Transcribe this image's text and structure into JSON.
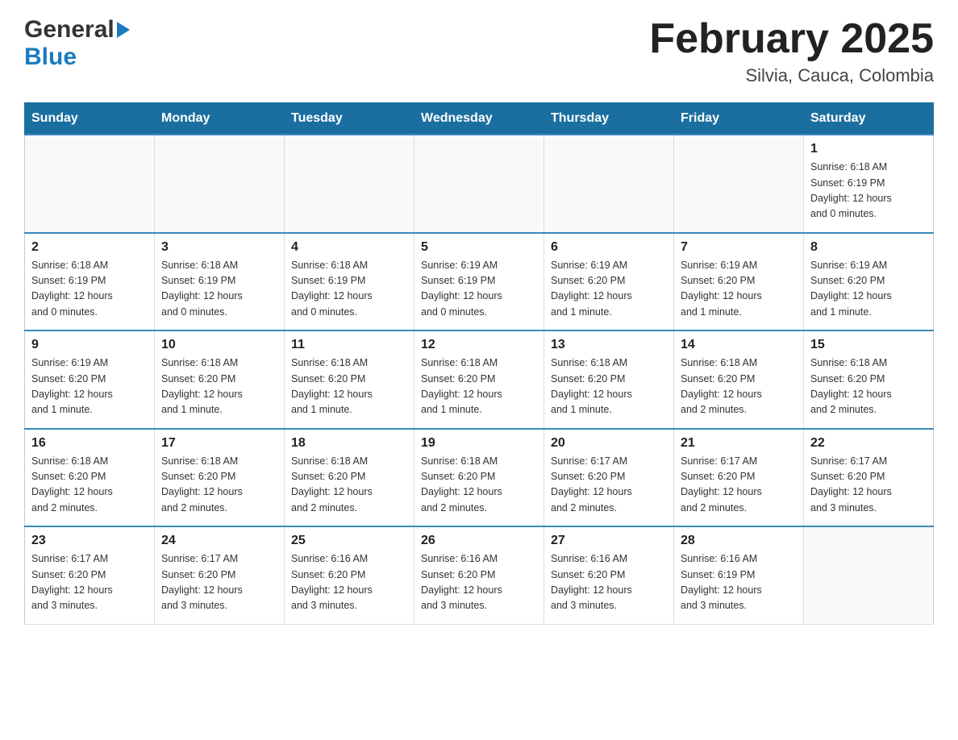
{
  "header": {
    "logo_general": "General",
    "logo_blue": "Blue",
    "month_title": "February 2025",
    "location": "Silvia, Cauca, Colombia"
  },
  "days_of_week": [
    "Sunday",
    "Monday",
    "Tuesday",
    "Wednesday",
    "Thursday",
    "Friday",
    "Saturday"
  ],
  "weeks": [
    {
      "days": [
        {
          "num": "",
          "info": ""
        },
        {
          "num": "",
          "info": ""
        },
        {
          "num": "",
          "info": ""
        },
        {
          "num": "",
          "info": ""
        },
        {
          "num": "",
          "info": ""
        },
        {
          "num": "",
          "info": ""
        },
        {
          "num": "1",
          "info": "Sunrise: 6:18 AM\nSunset: 6:19 PM\nDaylight: 12 hours\nand 0 minutes."
        }
      ]
    },
    {
      "days": [
        {
          "num": "2",
          "info": "Sunrise: 6:18 AM\nSunset: 6:19 PM\nDaylight: 12 hours\nand 0 minutes."
        },
        {
          "num": "3",
          "info": "Sunrise: 6:18 AM\nSunset: 6:19 PM\nDaylight: 12 hours\nand 0 minutes."
        },
        {
          "num": "4",
          "info": "Sunrise: 6:18 AM\nSunset: 6:19 PM\nDaylight: 12 hours\nand 0 minutes."
        },
        {
          "num": "5",
          "info": "Sunrise: 6:19 AM\nSunset: 6:19 PM\nDaylight: 12 hours\nand 0 minutes."
        },
        {
          "num": "6",
          "info": "Sunrise: 6:19 AM\nSunset: 6:20 PM\nDaylight: 12 hours\nand 1 minute."
        },
        {
          "num": "7",
          "info": "Sunrise: 6:19 AM\nSunset: 6:20 PM\nDaylight: 12 hours\nand 1 minute."
        },
        {
          "num": "8",
          "info": "Sunrise: 6:19 AM\nSunset: 6:20 PM\nDaylight: 12 hours\nand 1 minute."
        }
      ]
    },
    {
      "days": [
        {
          "num": "9",
          "info": "Sunrise: 6:19 AM\nSunset: 6:20 PM\nDaylight: 12 hours\nand 1 minute."
        },
        {
          "num": "10",
          "info": "Sunrise: 6:18 AM\nSunset: 6:20 PM\nDaylight: 12 hours\nand 1 minute."
        },
        {
          "num": "11",
          "info": "Sunrise: 6:18 AM\nSunset: 6:20 PM\nDaylight: 12 hours\nand 1 minute."
        },
        {
          "num": "12",
          "info": "Sunrise: 6:18 AM\nSunset: 6:20 PM\nDaylight: 12 hours\nand 1 minute."
        },
        {
          "num": "13",
          "info": "Sunrise: 6:18 AM\nSunset: 6:20 PM\nDaylight: 12 hours\nand 1 minute."
        },
        {
          "num": "14",
          "info": "Sunrise: 6:18 AM\nSunset: 6:20 PM\nDaylight: 12 hours\nand 2 minutes."
        },
        {
          "num": "15",
          "info": "Sunrise: 6:18 AM\nSunset: 6:20 PM\nDaylight: 12 hours\nand 2 minutes."
        }
      ]
    },
    {
      "days": [
        {
          "num": "16",
          "info": "Sunrise: 6:18 AM\nSunset: 6:20 PM\nDaylight: 12 hours\nand 2 minutes."
        },
        {
          "num": "17",
          "info": "Sunrise: 6:18 AM\nSunset: 6:20 PM\nDaylight: 12 hours\nand 2 minutes."
        },
        {
          "num": "18",
          "info": "Sunrise: 6:18 AM\nSunset: 6:20 PM\nDaylight: 12 hours\nand 2 minutes."
        },
        {
          "num": "19",
          "info": "Sunrise: 6:18 AM\nSunset: 6:20 PM\nDaylight: 12 hours\nand 2 minutes."
        },
        {
          "num": "20",
          "info": "Sunrise: 6:17 AM\nSunset: 6:20 PM\nDaylight: 12 hours\nand 2 minutes."
        },
        {
          "num": "21",
          "info": "Sunrise: 6:17 AM\nSunset: 6:20 PM\nDaylight: 12 hours\nand 2 minutes."
        },
        {
          "num": "22",
          "info": "Sunrise: 6:17 AM\nSunset: 6:20 PM\nDaylight: 12 hours\nand 3 minutes."
        }
      ]
    },
    {
      "days": [
        {
          "num": "23",
          "info": "Sunrise: 6:17 AM\nSunset: 6:20 PM\nDaylight: 12 hours\nand 3 minutes."
        },
        {
          "num": "24",
          "info": "Sunrise: 6:17 AM\nSunset: 6:20 PM\nDaylight: 12 hours\nand 3 minutes."
        },
        {
          "num": "25",
          "info": "Sunrise: 6:16 AM\nSunset: 6:20 PM\nDaylight: 12 hours\nand 3 minutes."
        },
        {
          "num": "26",
          "info": "Sunrise: 6:16 AM\nSunset: 6:20 PM\nDaylight: 12 hours\nand 3 minutes."
        },
        {
          "num": "27",
          "info": "Sunrise: 6:16 AM\nSunset: 6:20 PM\nDaylight: 12 hours\nand 3 minutes."
        },
        {
          "num": "28",
          "info": "Sunrise: 6:16 AM\nSunset: 6:19 PM\nDaylight: 12 hours\nand 3 minutes."
        },
        {
          "num": "",
          "info": ""
        }
      ]
    }
  ]
}
